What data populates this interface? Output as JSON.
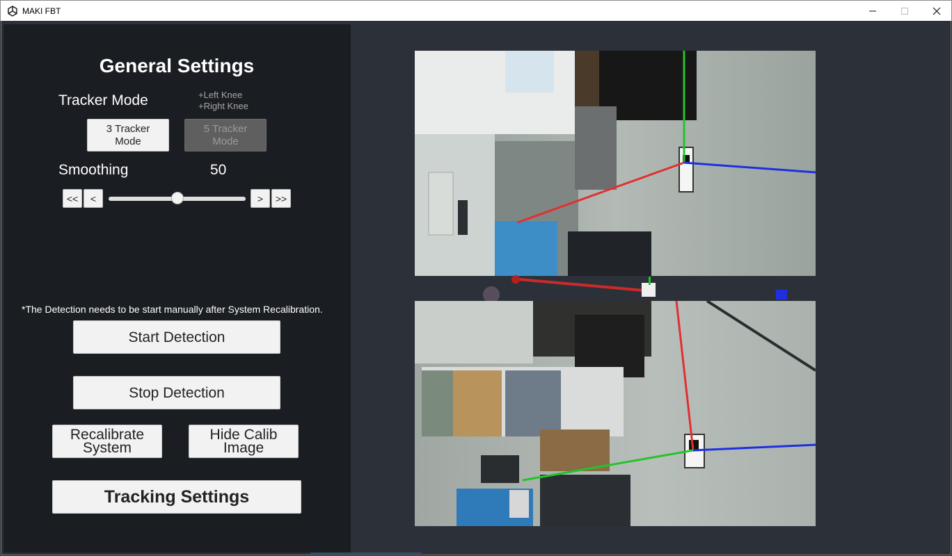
{
  "window": {
    "title": "MAKI FBT",
    "icon": "unity-logo-icon",
    "controls": [
      "minimize-icon",
      "maximize-icon",
      "close-icon"
    ]
  },
  "settings": {
    "heading": "General Settings",
    "tracker_mode_label": "Tracker Mode",
    "tracker_hint_line1": "+Left    Knee",
    "tracker_hint_line2": "+Right Knee",
    "mode3_line1": "3 Tracker",
    "mode3_line2": "Mode",
    "mode5_line1": "5 Tracker",
    "mode5_line2": "Mode",
    "smoothing_label": "Smoothing",
    "smoothing_value": "50",
    "smoothing_level": 0.5,
    "step_buttons": {
      "fast_back": "<<",
      "back": "<",
      "forward": ">",
      "fast_forward": ">>"
    }
  },
  "detection": {
    "note": "*The Detection needs to be start manually after System Recalibration.",
    "start_label": "Start Detection",
    "stop_label": "Stop Detection",
    "recalibrate_line1": "Recalibrate",
    "recalibrate_line2": "System",
    "hide_calib_line1": "Hide Calib",
    "hide_calib_line2": "Image",
    "tracking_settings_label": "Tracking Settings"
  },
  "colors": {
    "panel": "#1a1d22",
    "viewport": "#2c3139",
    "axis_x": "#e03030",
    "axis_y": "#22c42a",
    "axis_z": "#1e2fe0"
  }
}
